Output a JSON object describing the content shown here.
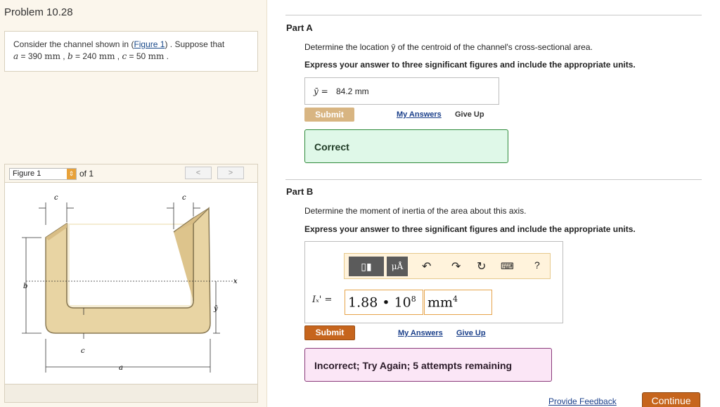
{
  "problem": {
    "title": "Problem 10.28",
    "text_pre": "Consider the channel shown in (",
    "figure_link": "Figure 1",
    "text_post": ") . Suppose that",
    "params": [
      {
        "var": "a",
        "eq": " = 390 ",
        "unit": "mm"
      },
      {
        "var": "b",
        "eq": " = 240 ",
        "unit": "mm"
      },
      {
        "var": "c",
        "eq": " = 50 ",
        "unit": "mm"
      }
    ]
  },
  "figure": {
    "select_label": "Figure 1",
    "of_label": "of 1",
    "prev": "<",
    "next": ">",
    "labels": {
      "c_left": "c",
      "c_right": "c",
      "b": "b",
      "x": "x",
      "ybar": "ȳ",
      "c_bottom": "c",
      "a": "a"
    }
  },
  "partA": {
    "title": "Part A",
    "question": "Determine the location ȳ of the centroid of the channel's cross-sectional area.",
    "instruction": "Express your answer to three significant figures and include the appropriate units.",
    "answer_label": "ȳ =",
    "answer_value": "84.2 mm",
    "submit": "Submit",
    "my_answers": "My Answers",
    "give_up": "Give Up",
    "result": "Correct"
  },
  "partB": {
    "title": "Part B",
    "question": "Determine the moment of inertia of the area about this axis.",
    "instruction": "Express your answer to three significant figures and include the appropriate units.",
    "toolbar": {
      "templates": "▯▮",
      "units": "μÅ",
      "help": "?"
    },
    "answer_label": "Iₓ' =",
    "value_base": "1.88 • 10",
    "value_exp": "8",
    "unit_base": "mm",
    "unit_exp": "4",
    "submit": "Submit",
    "my_answers": "My Answers",
    "give_up": "Give Up",
    "result": "Incorrect; Try Again; 5 attempts remaining"
  },
  "footer": {
    "feedback": "Provide Feedback",
    "continue": "Continue"
  },
  "colors": {
    "accent": "#c6651d",
    "correct_bg": "#dff8e8",
    "incorrect_bg": "#fbe6f6"
  }
}
